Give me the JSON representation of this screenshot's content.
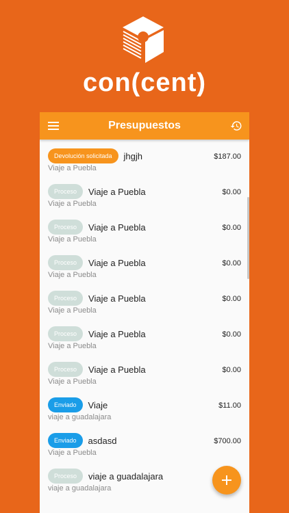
{
  "brand": {
    "wordmark": "con(cent)"
  },
  "colors": {
    "background": "#e8661a",
    "appbar": "#f7941d",
    "badge_devolucion": "#f7941d",
    "badge_proceso": "#cfded9",
    "badge_enviado": "#1a9de8"
  },
  "appbar": {
    "title": "Presupuestos",
    "left_icon": "hamburger-menu-icon",
    "right_icon": "history-icon"
  },
  "items": [
    {
      "status": "Devolución solicitada",
      "name": "jhgjh",
      "amount": "$187.00",
      "subtitle": "Viaje a Puebla"
    },
    {
      "status": "Proceso",
      "name": "Viaje a Puebla",
      "amount": "$0.00",
      "subtitle": "Viaje a Puebla"
    },
    {
      "status": "Proceso",
      "name": "Viaje a Puebla",
      "amount": "$0.00",
      "subtitle": "Viaje a Puebla"
    },
    {
      "status": "Proceso",
      "name": "Viaje a Puebla",
      "amount": "$0.00",
      "subtitle": "Viaje a Puebla"
    },
    {
      "status": "Proceso",
      "name": "Viaje a Puebla",
      "amount": "$0.00",
      "subtitle": "Viaje a Puebla"
    },
    {
      "status": "Proceso",
      "name": "Viaje a Puebla",
      "amount": "$0.00",
      "subtitle": "Viaje a Puebla"
    },
    {
      "status": "Proceso",
      "name": "Viaje a Puebla",
      "amount": "$0.00",
      "subtitle": "Viaje a Puebla"
    },
    {
      "status": "Enviado",
      "name": "Viaje",
      "amount": "$11.00",
      "subtitle": "viaje a guadalajara"
    },
    {
      "status": "Enviado",
      "name": "asdasd",
      "amount": "$700.00",
      "subtitle": "Viaje a Puebla"
    },
    {
      "status": "Proceso",
      "name": "viaje a guadalajara",
      "amount": "",
      "subtitle": "viaje a guadalajara"
    }
  ],
  "fab": {
    "icon": "plus-icon"
  }
}
